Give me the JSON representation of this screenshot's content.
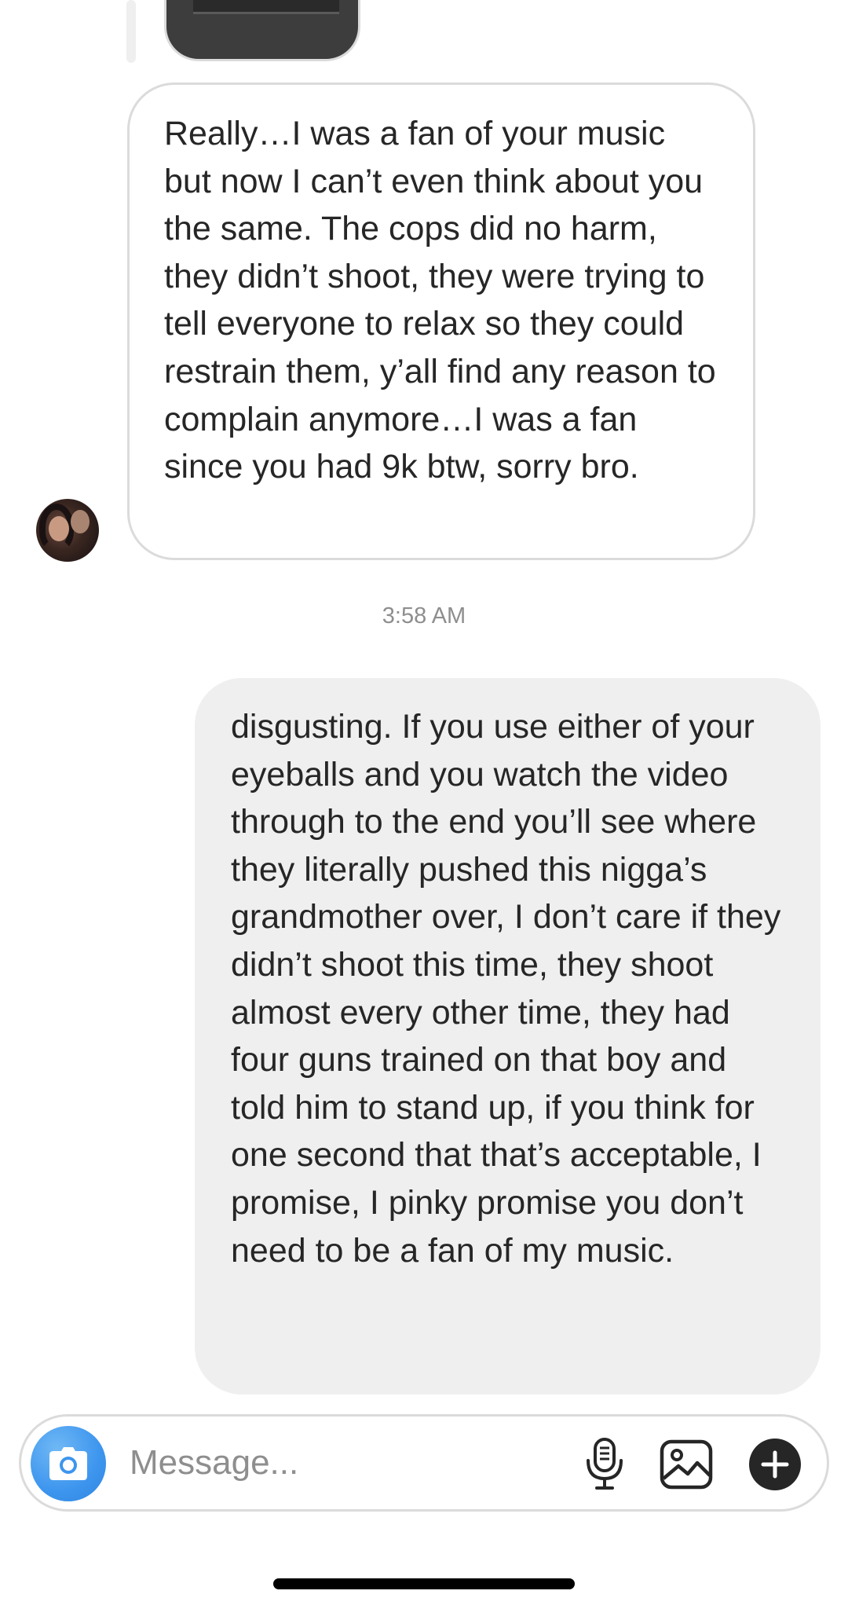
{
  "thread": {
    "incoming_message": {
      "text": "Really…I was a fan of your music but now I can’t even think about you the same. The cops did no harm, they didn’t shoot, they were trying to tell everyone to relax so they could restrain them, y’all find any reason to complain anymore…I was a fan since you had 9k btw, sorry bro."
    },
    "timestamp": "3:58 AM",
    "outgoing_message": {
      "text": "disgusting. If you use either of your eyeballs and you watch the video through to the end you’ll see where they literally pushed this nigga’s grandmother over, I don’t care if they didn’t shoot this time, they shoot almost every other time, they had four guns trained on that boy and told him to stand up, if you think for one second that that’s acceptable, I promise, I pinky promise you don’t need to be a fan of my music."
    }
  },
  "composer": {
    "placeholder": "Message...",
    "value": "",
    "camera_icon": "camera-icon",
    "mic_icon": "microphone-icon",
    "gallery_icon": "gallery-icon",
    "plus_icon": "plus-icon"
  },
  "colors": {
    "incoming_bubble_border": "#dbdbdb",
    "outgoing_bubble_bg": "#efefef",
    "camera_button": "#3d95ee",
    "timestamp": "#8e8e8e"
  }
}
